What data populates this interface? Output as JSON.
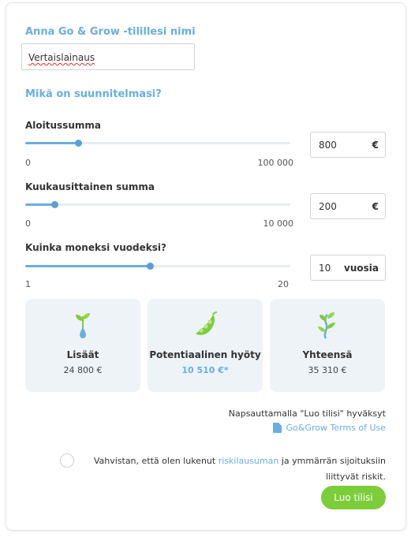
{
  "account": {
    "heading": "Anna Go & Grow -tilillesi nimi",
    "name_value": "Vertaislainaus"
  },
  "plan": {
    "heading": "Mikä on suunnitelmasi?",
    "sliders": [
      {
        "label": "Aloitussumma",
        "min": "0",
        "max": "100 000",
        "value": "800",
        "unit": "€",
        "fraction": 0.2
      },
      {
        "label": "Kuukausittainen summa",
        "min": "0",
        "max": "10 000",
        "value": "200",
        "unit": "€",
        "fraction": 0.11
      },
      {
        "label": "Kuinka moneksi vuodeksi?",
        "min": "1",
        "max": "20",
        "value": "10",
        "unit": "vuosia",
        "fraction": 0.47
      }
    ]
  },
  "summary": [
    {
      "title": "Lisäät",
      "value": "24 800 €",
      "icon": "sprout-drop-icon"
    },
    {
      "title": "Potentiaalinen hyöty",
      "value": "10 510 €*",
      "icon": "pea-pod-icon"
    },
    {
      "title": "Yhteensä",
      "value": "35 310 €",
      "icon": "growing-plant-icon"
    }
  ],
  "terms": {
    "text": "Napsauttamalla \"Luo tilisi\" hyväksyt",
    "link": "Go&Grow Terms of Use"
  },
  "confirm": {
    "before": "Vahvistan, että olen lukenut ",
    "link": "riskilausuman",
    "after": " ja ymmärrän sijoituksiin liittyvät riskit."
  },
  "button": {
    "label": "Luo tilisi"
  },
  "colors": {
    "accent": "#6aaee0",
    "button": "#7ccd3a",
    "tile_bg": "#eef3f8",
    "icon_green": "#7ccd3a"
  }
}
